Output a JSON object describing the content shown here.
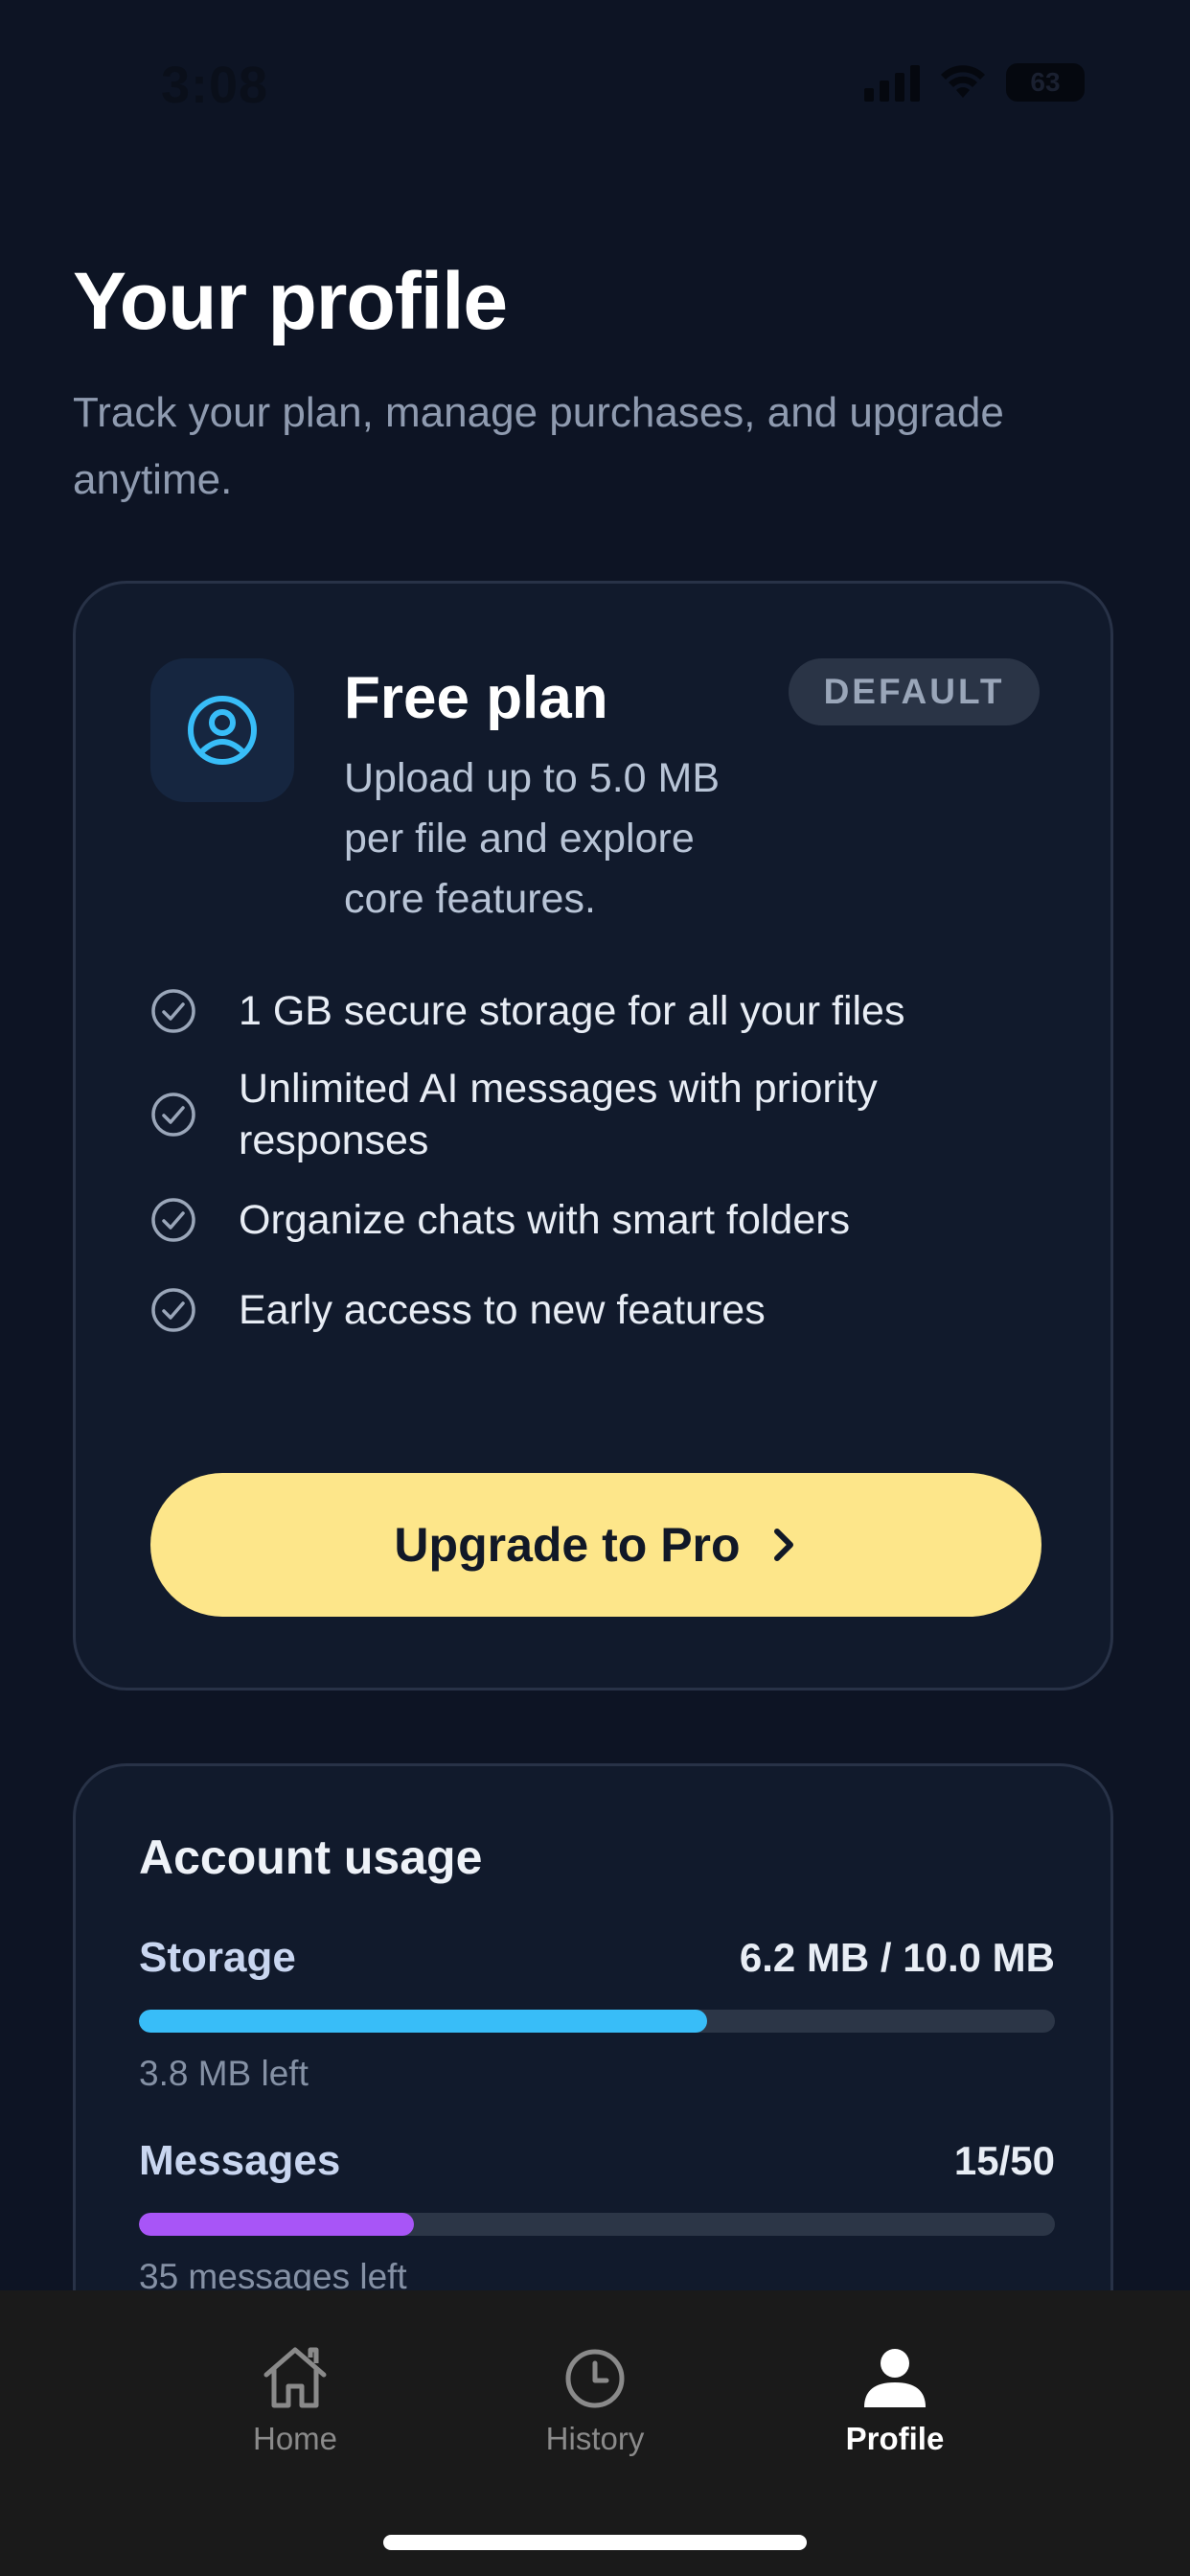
{
  "status_bar": {
    "time": "3:08",
    "battery": "63"
  },
  "header": {
    "title": "Your profile",
    "subtitle": "Track your plan, manage purchases, and upgrade anytime."
  },
  "plan": {
    "icon": "user-circle-icon",
    "name": "Free plan",
    "description": "Upload up to 5.0 MB per file and explore core features.",
    "badge": "DEFAULT",
    "features": [
      "1 GB secure storage for all your files",
      "Unlimited AI messages with priority responses",
      "Organize chats with smart folders",
      "Early access to new features"
    ],
    "upgrade_label": "Upgrade to Pro",
    "colors": {
      "accent": "#38bdf8",
      "button": "#fde68a"
    }
  },
  "usage": {
    "title": "Account usage",
    "storage": {
      "label": "Storage",
      "value": "6.2 MB / 10.0 MB",
      "note": "3.8 MB left",
      "fraction": 0.62,
      "color": "#38bdf8"
    },
    "messages": {
      "label": "Messages",
      "value": "15/50",
      "note": "35 messages left",
      "fraction": 0.3,
      "color": "#a855f7"
    }
  },
  "tabs": [
    {
      "label": "Home",
      "icon": "home-icon",
      "active": false
    },
    {
      "label": "History",
      "icon": "clock-icon",
      "active": false
    },
    {
      "label": "Profile",
      "icon": "person-icon",
      "active": true
    }
  ]
}
